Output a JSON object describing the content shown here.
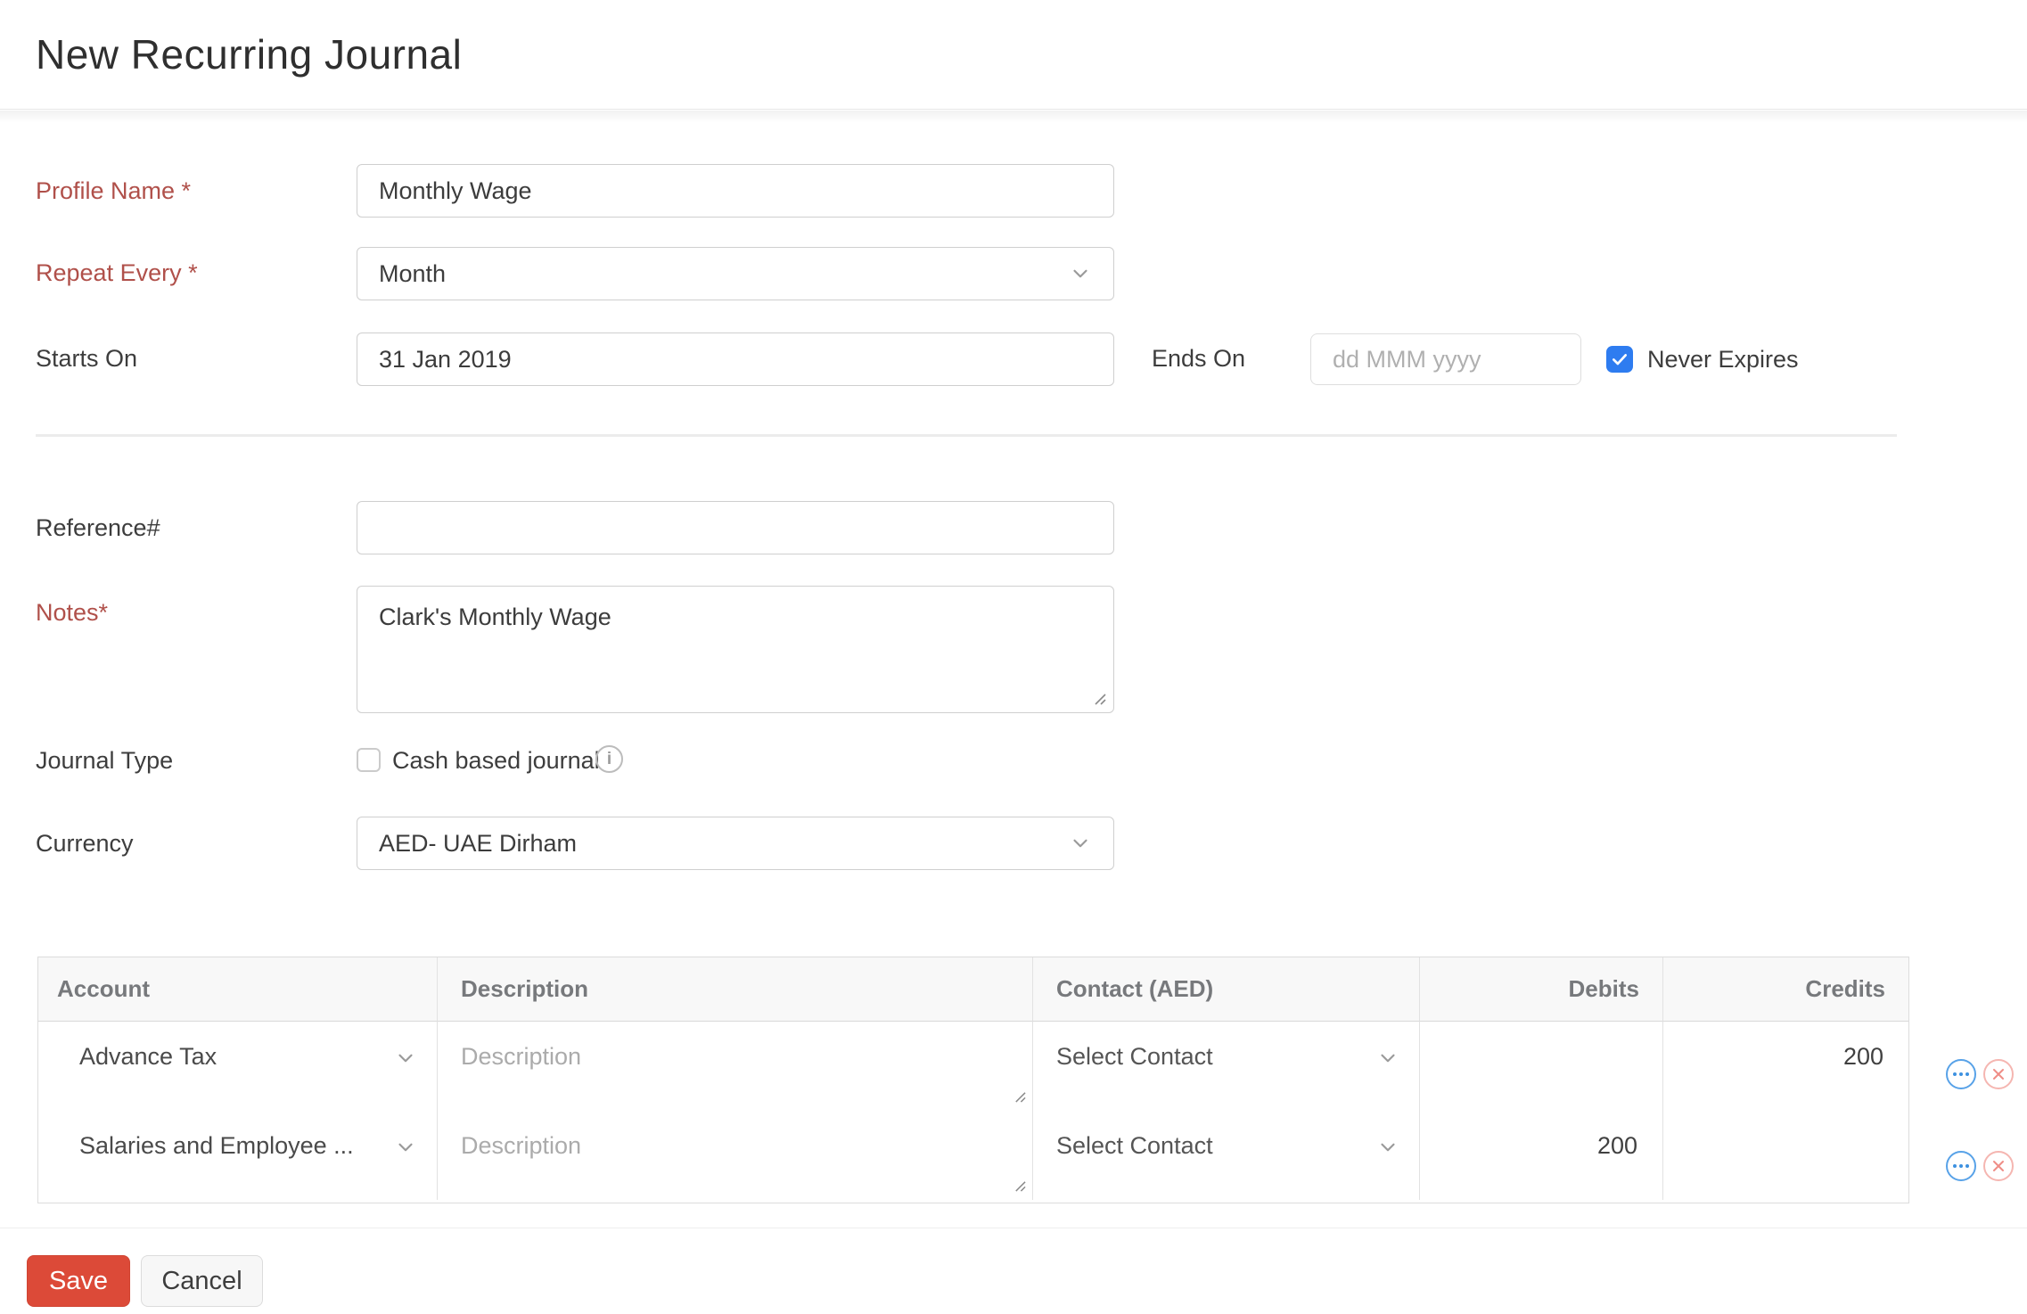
{
  "page_title": "New Recurring Journal",
  "form": {
    "profile_name": {
      "label": "Profile Name *",
      "value": "Monthly Wage"
    },
    "repeat_every": {
      "label": "Repeat Every *",
      "value": "Month"
    },
    "starts_on": {
      "label": "Starts On",
      "value": "31 Jan 2019"
    },
    "ends_on": {
      "label": "Ends On",
      "placeholder": "dd MMM yyyy"
    },
    "never_expires": {
      "label": "Never Expires",
      "checked": true
    },
    "reference": {
      "label": "Reference#",
      "value": ""
    },
    "notes": {
      "label": "Notes*",
      "value": "Clark's Monthly Wage"
    },
    "journal_type": {
      "label": "Journal Type",
      "checkbox_label": "Cash based journal",
      "checked": false
    },
    "currency": {
      "label": "Currency",
      "value": "AED- UAE Dirham"
    }
  },
  "table": {
    "columns": [
      "Account",
      "Description",
      "Contact (AED)",
      "Debits",
      "Credits"
    ],
    "rows": [
      {
        "account": "Advance Tax",
        "description_placeholder": "Description",
        "contact": "Select Contact",
        "debits": "",
        "credits": "200"
      },
      {
        "account": "Salaries and Employee ...",
        "description_placeholder": "Description",
        "contact": "Select Contact",
        "debits": "200",
        "credits": ""
      }
    ]
  },
  "footer": {
    "save": "Save",
    "cancel": "Cancel"
  },
  "colors": {
    "required_label": "#b0504a",
    "accent_blue": "#2e7cf0",
    "save_button": "#dc4a38",
    "header_bg": "#f8f8f8"
  }
}
